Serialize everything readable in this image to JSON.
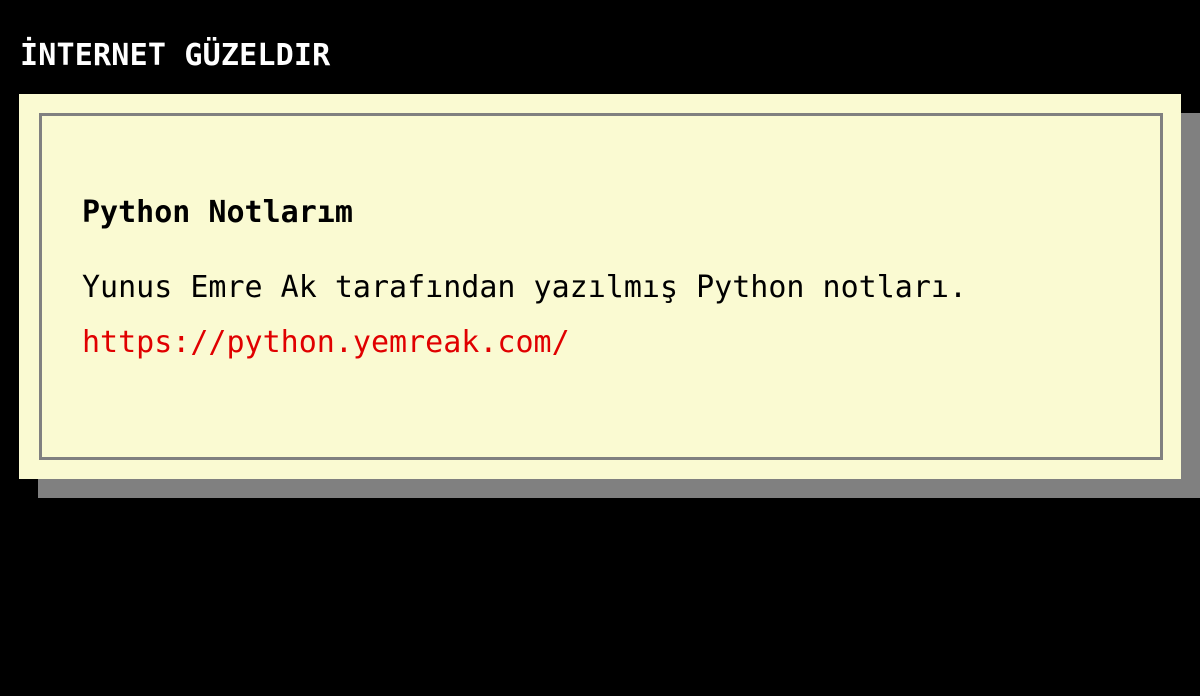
{
  "header": {
    "title": "İNTERNET GÜZELDIR"
  },
  "entry": {
    "title": "Python Notlarım",
    "description": "Yunus Emre Ak tarafından yazılmış Python notları.",
    "link_text": "https://python.yemreak.com/",
    "link_href": "https://python.yemreak.com/"
  },
  "colors": {
    "background": "#000000",
    "card": "#fafad2",
    "card_shadow": "#808080",
    "border": "#808080",
    "link": "#e00000",
    "title_text": "#ffffff"
  }
}
